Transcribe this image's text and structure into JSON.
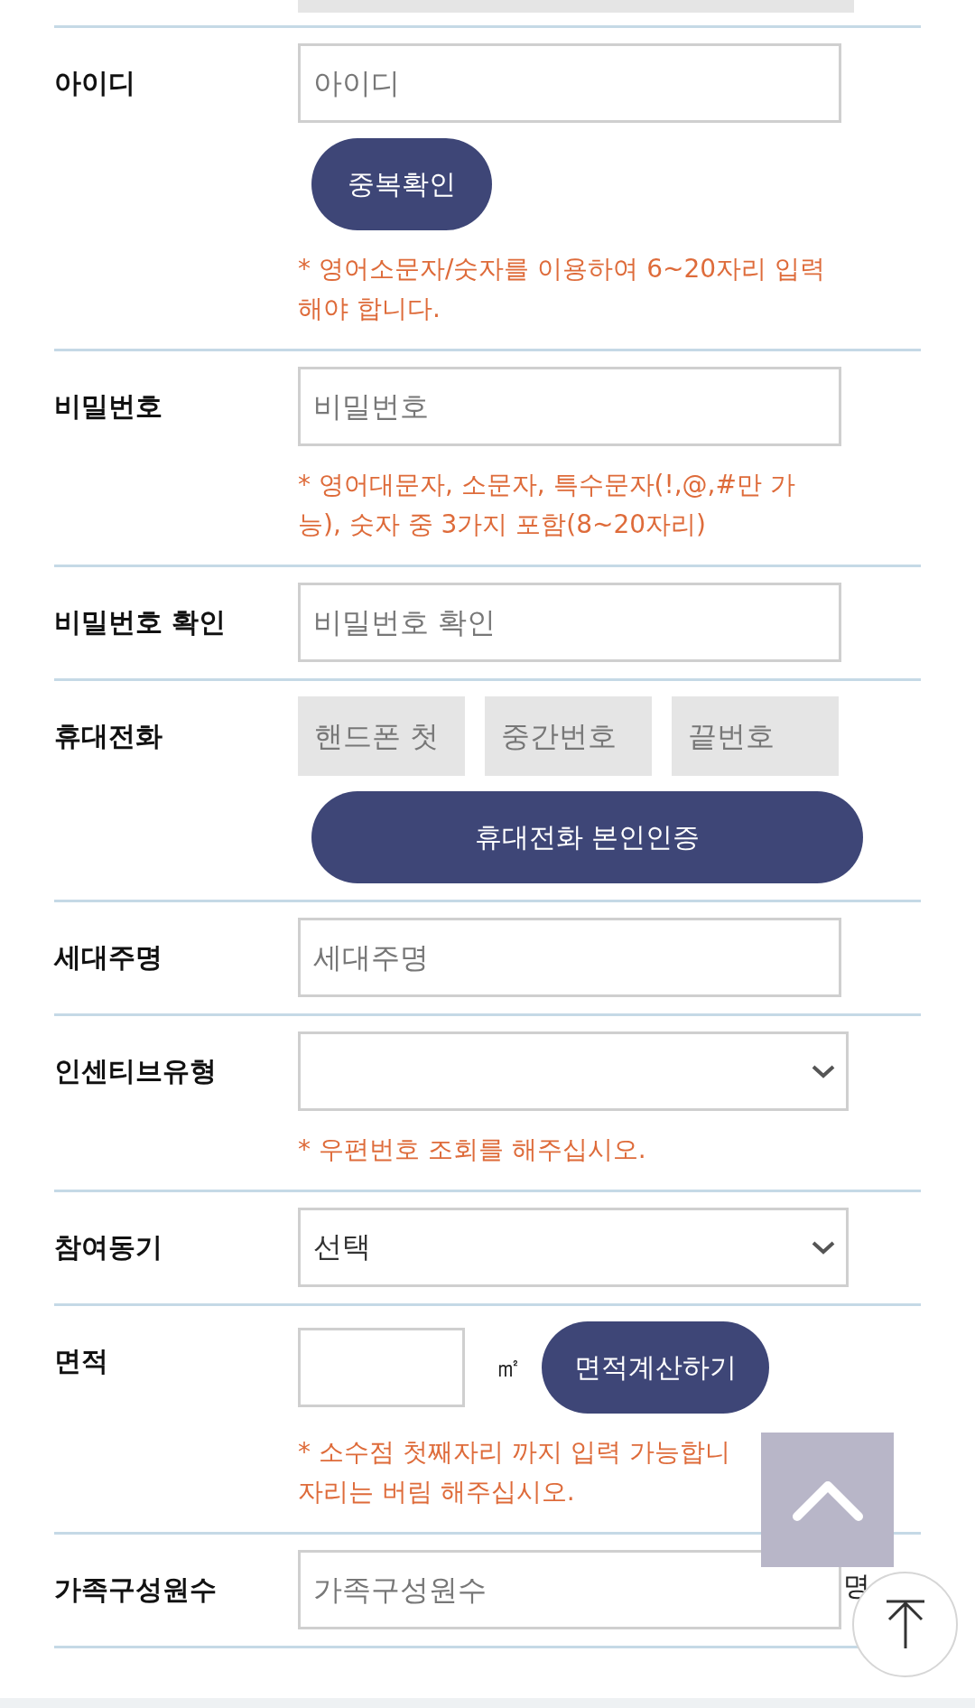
{
  "rows": [
    {
      "label": "아이디",
      "controls": [
        {
          "kind": "input",
          "placeholder": "아이디"
        },
        {
          "kind": "button",
          "label": "중복확인"
        }
      ],
      "note": [
        "* 영어소문자/숫자를 이용하여 6~20자리 입력",
        "해야 합니다."
      ]
    },
    {
      "label": "비밀번호",
      "controls": [
        {
          "kind": "input",
          "placeholder": "비밀번호"
        }
      ],
      "note": [
        "* 영어대문자, 소문자, 특수문자(!,@,#만 가",
        "능), 숫자 중 3가지 포함(8~20자리)"
      ]
    },
    {
      "label": "비밀번호 확인",
      "controls": [
        {
          "kind": "input",
          "placeholder": "비밀번호 확인"
        }
      ]
    },
    {
      "label": "휴대전화",
      "controls": [
        {
          "kind": "phone",
          "disabled": true,
          "placeholders": [
            "핸드폰 첫",
            "중간번호",
            "끝번호"
          ]
        },
        {
          "kind": "wide_button",
          "label": "휴대전화 본인인증"
        }
      ]
    },
    {
      "label": "세대주명",
      "controls": [
        {
          "kind": "input",
          "placeholder": "세대주명"
        }
      ]
    },
    {
      "label": "인센티브유형",
      "controls": [
        {
          "kind": "select"
        }
      ],
      "note": [
        "* 우편번호 조회를 해주십시오."
      ]
    },
    {
      "label": "참여동기",
      "controls": [
        {
          "kind": "select",
          "value": "선택"
        }
      ]
    },
    {
      "label": "면적",
      "controls": [
        {
          "kind": "area",
          "unit": "㎡",
          "button": "면적계산하기"
        }
      ],
      "note": [
        "* 소수점 첫째자리 까지 입력 가능합니",
        "자리는 버림 해주십시오."
      ]
    },
    {
      "label": "가족구성원수",
      "controls": [
        {
          "kind": "input",
          "placeholder": "가족구성원수",
          "unit": "명"
        }
      ]
    }
  ]
}
